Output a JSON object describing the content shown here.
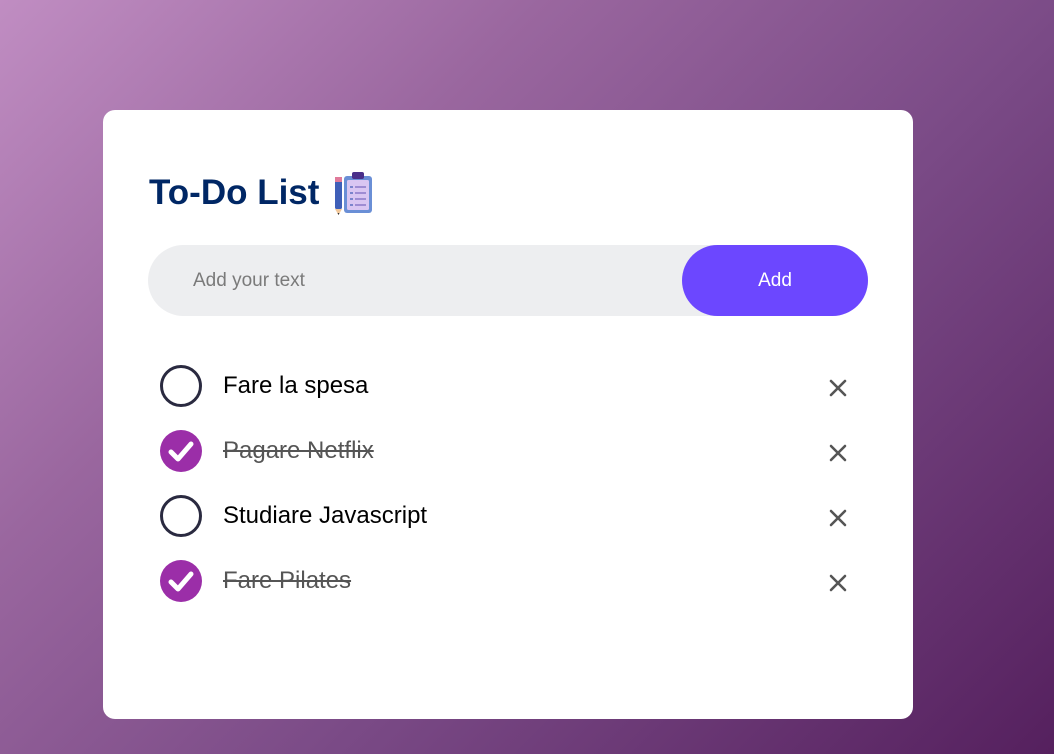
{
  "app": {
    "title": "To-Do List",
    "title_icon": "clipboard-icon"
  },
  "input": {
    "value": "",
    "placeholder": "Add your text"
  },
  "add_button": {
    "label": "Add"
  },
  "tasks": [
    {
      "text": "Fare la spesa",
      "checked": false
    },
    {
      "text": "Pagare Netflix",
      "checked": true
    },
    {
      "text": "Studiare Javascript",
      "checked": false
    },
    {
      "text": "Fare Pilates",
      "checked": true
    }
  ],
  "icons": {
    "check": "check-icon",
    "remove": "close-icon"
  },
  "colors": {
    "title": "#002765",
    "accent_button": "#6c47ff",
    "checked": "#9b2ea8",
    "unchecked_border": "#2a2a40",
    "input_background": "#edeef0"
  }
}
